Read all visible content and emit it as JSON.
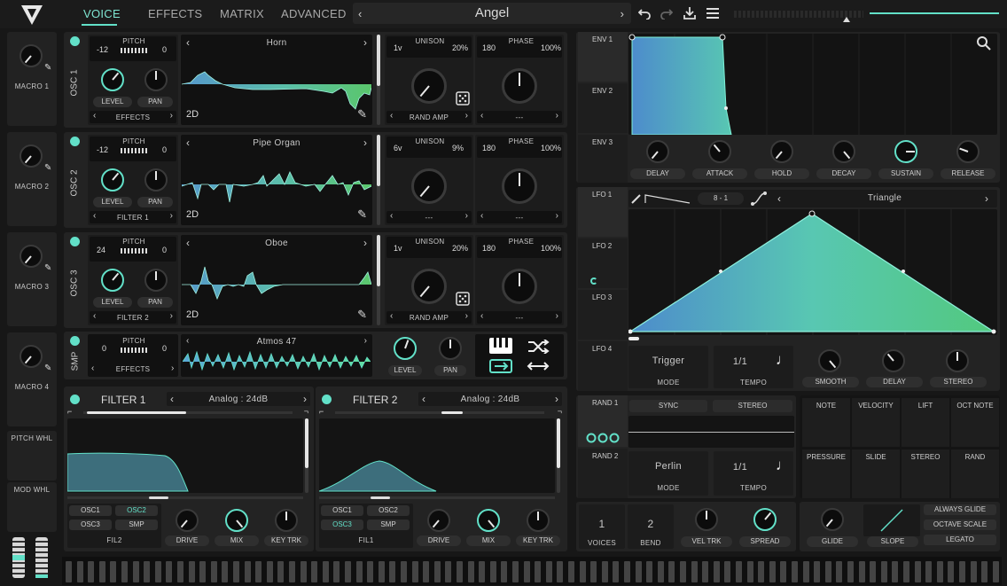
{
  "app": {
    "preset_name": "Angel"
  },
  "tabs": [
    {
      "label": "VOICE"
    },
    {
      "label": "EFFECTS"
    },
    {
      "label": "MATRIX"
    },
    {
      "label": "ADVANCED"
    }
  ],
  "macros": [
    {
      "label": "MACRO 1"
    },
    {
      "label": "MACRO 2"
    },
    {
      "label": "MACRO 3"
    },
    {
      "label": "MACRO 4"
    }
  ],
  "wheels": {
    "pitch": "PITCH WHL",
    "mod": "MOD WHL"
  },
  "oscillators": [
    {
      "name": "OSC 1",
      "transpose": "-12",
      "tune": "0",
      "wave": "Horn",
      "mode": "2D",
      "unison_voices": "1v",
      "unison_detune": "20%",
      "phase": "180",
      "phase_rand": "100%",
      "dest": "EFFECTS",
      "spectral": "RAND AMP",
      "phase_dest": "---"
    },
    {
      "name": "OSC 2",
      "transpose": "-12",
      "tune": "0",
      "wave": "Pipe Organ",
      "mode": "2D",
      "unison_voices": "6v",
      "unison_detune": "9%",
      "phase": "180",
      "phase_rand": "100%",
      "dest": "FILTER 1",
      "spectral": "---",
      "phase_dest": "---"
    },
    {
      "name": "OSC 3",
      "transpose": "24",
      "tune": "0",
      "wave": "Oboe",
      "mode": "2D",
      "unison_voices": "1v",
      "unison_detune": "20%",
      "phase": "180",
      "phase_rand": "100%",
      "dest": "FILTER 2",
      "spectral": "RAND AMP",
      "phase_dest": "---"
    }
  ],
  "osc_labels": {
    "pitch": "PITCH",
    "level": "LEVEL",
    "pan": "PAN",
    "unison": "UNISON",
    "phase": "PHASE"
  },
  "sampler": {
    "name": "SMP",
    "transpose": "0",
    "tune": "0",
    "sample": "Atmos 47",
    "dest": "EFFECTS"
  },
  "filters": [
    {
      "name": "FILTER 1",
      "model": "Analog : 24dB",
      "routes": [
        "OSC1",
        "OSC2",
        "OSC3",
        "SMP"
      ],
      "link": "FIL2"
    },
    {
      "name": "FILTER 2",
      "model": "Analog : 24dB",
      "routes": [
        "OSC1",
        "OSC2",
        "OSC3",
        "SMP"
      ],
      "link": "FIL1"
    }
  ],
  "filter_labels": {
    "drive": "DRIVE",
    "mix": "MIX",
    "keytrk": "KEY TRK"
  },
  "envelopes": {
    "tabs": [
      "ENV 1",
      "ENV 2",
      "ENV 3"
    ],
    "knobs": [
      "DELAY",
      "ATTACK",
      "HOLD",
      "DECAY",
      "SUSTAIN",
      "RELEASE"
    ]
  },
  "lfo": {
    "tabs": [
      "LFO 1",
      "LFO 2",
      "LFO 3",
      "LFO 4"
    ],
    "grid_x": "8",
    "grid_y": "1",
    "dash": "-",
    "shape": "Triangle",
    "mode": "Trigger",
    "mode_label": "MODE",
    "tempo": "1/1",
    "tempo_label": "TEMPO",
    "knobs": [
      "SMOOTH",
      "DELAY",
      "STEREO"
    ]
  },
  "random": {
    "tabs": [
      "RAND 1",
      "RAND 2"
    ],
    "sync": "SYNC",
    "stereo": "STEREO",
    "style": "Perlin",
    "mode_label": "MODE",
    "tempo": "1/1",
    "tempo_label": "TEMPO"
  },
  "mod_sources": [
    "NOTE",
    "VELOCITY",
    "LIFT",
    "OCT NOTE",
    "PRESSURE",
    "SLIDE",
    "STEREO",
    "RAND"
  ],
  "voice": {
    "voices": "1",
    "voices_label": "VOICES",
    "bend": "2",
    "bend_label": "BEND",
    "veltrk": "VEL TRK",
    "spread": "SPREAD"
  },
  "glide": {
    "glide": "GLIDE",
    "slope": "SLOPE",
    "options": [
      "ALWAYS GLIDE",
      "OCTAVE SCALE",
      "LEGATO"
    ]
  },
  "colors": {
    "accent": "#62e0c8",
    "bg": "#171717"
  }
}
